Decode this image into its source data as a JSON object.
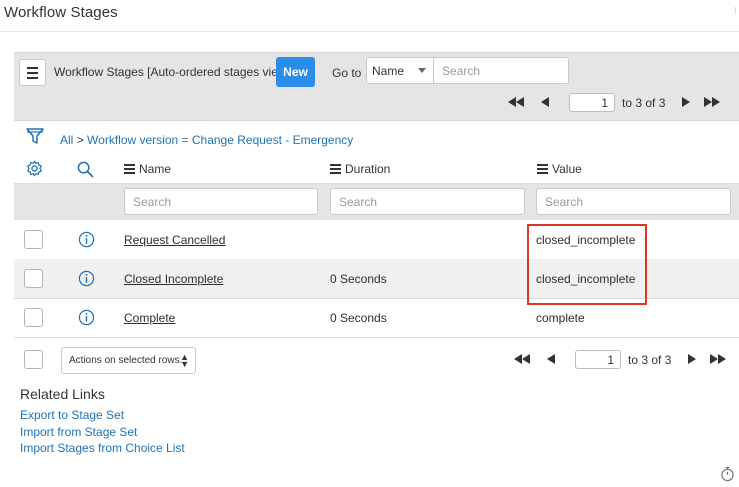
{
  "page": {
    "title": "Workflow Stages"
  },
  "toolbar": {
    "list_title": "Workflow Stages [Auto-ordered stages view]",
    "new_label": "New",
    "goto_label": "Go to",
    "goto_field": "Name",
    "search_placeholder": "Search"
  },
  "pager": {
    "page": "1",
    "range": "to 3 of 3"
  },
  "breadcrumb": {
    "all": "All",
    "separator": ">",
    "filter": "Workflow version = Change Request - Emergency"
  },
  "columns": {
    "name": "Name",
    "duration": "Duration",
    "value": "Value"
  },
  "column_search": {
    "placeholder": "Search"
  },
  "rows": [
    {
      "name": "Request Cancelled",
      "duration": "",
      "value": "closed_incomplete"
    },
    {
      "name": "Closed Incomplete",
      "duration": "0 Seconds",
      "value": "closed_incomplete"
    },
    {
      "name": "Complete",
      "duration": "0 Seconds",
      "value": "complete"
    }
  ],
  "footer": {
    "actions_label": "Actions on selected rows...",
    "page": "1",
    "range": "to 3 of 3"
  },
  "related": {
    "title": "Related Links",
    "links": [
      "Export to Stage Set",
      "Import from Stage Set",
      "Import Stages from Choice List"
    ]
  },
  "colors": {
    "primary": "#2a8dea",
    "link": "#1f73b7",
    "highlight": "#d63a24",
    "toolbar_bg": "#e5e5e5"
  },
  "icons": [
    "hamburger-icon",
    "filter-icon",
    "gear-icon",
    "search-icon",
    "info-icon",
    "first-page-icon",
    "prev-page-icon",
    "next-page-icon",
    "last-page-icon",
    "timer-icon"
  ]
}
